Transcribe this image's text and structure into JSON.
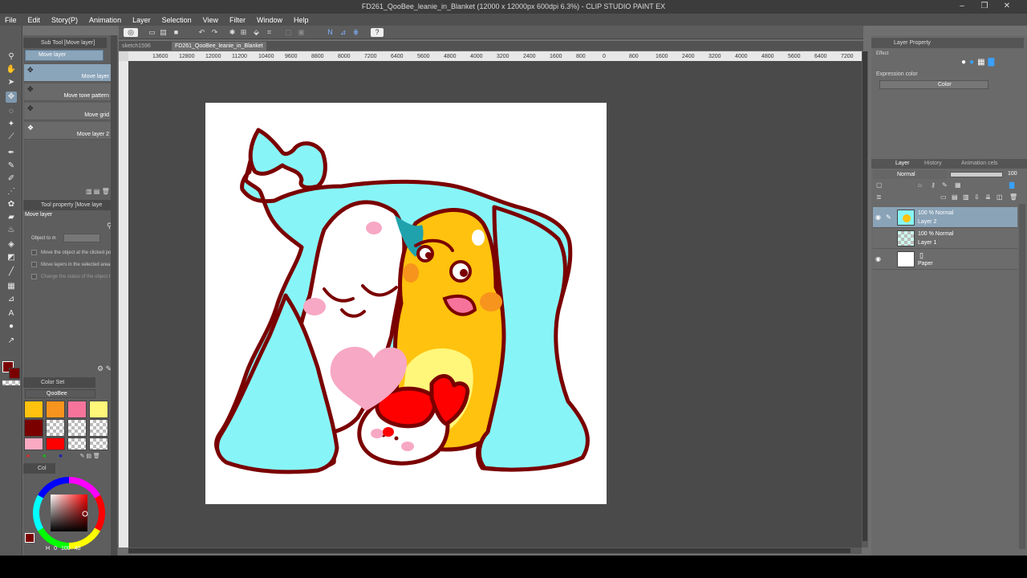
{
  "window": {
    "title": "FD261_QooBee_leanie_in_Blanket (12000 x 12000px 600dpi 6.3%)  - CLIP STUDIO PAINT EX"
  },
  "menu": [
    "File",
    "Edit",
    "Story(P)",
    "Animation",
    "Layer",
    "Selection",
    "View",
    "Filter",
    "Window",
    "Help"
  ],
  "subtool": {
    "header": "Sub Tool [Move layer]",
    "group_label": "Move layer",
    "items": [
      "Move layer",
      "Move tone pattern",
      "Move grid",
      "Move layer 2"
    ]
  },
  "tool_property": {
    "header": "Tool property [Move laye",
    "name": "Move layer",
    "object_label": "Object to m",
    "options": [
      "Move the object at the clicked pos",
      "Move layers in the selected area",
      "Change the status of the object t"
    ]
  },
  "color_set": {
    "header": "Color Set",
    "set_name": "QooBee",
    "colors": [
      "#ffc20e",
      "#f7941d",
      "#f6749c",
      "#fff77a",
      "#7a0000",
      "checker",
      "checker",
      "checker",
      "#f9a9c2",
      "#ff0000",
      "checker",
      "checker"
    ]
  },
  "color_wheel": {
    "tab": "Col",
    "h_label": "H",
    "h": "0",
    "s": "100",
    "v": "40",
    "main_color": "#7a0000"
  },
  "document_tabs": [
    "sketch1596",
    "FD261_QooBee_leanie_in_Blanket"
  ],
  "ruler_labels": [
    "13600",
    "12800",
    "12000",
    "11200",
    "10400",
    "9600",
    "8800",
    "8000",
    "7200",
    "6400",
    "5600",
    "4800",
    "4000",
    "3200",
    "2400",
    "1600",
    "800",
    "0",
    "800",
    "1600",
    "2400",
    "3200",
    "4000",
    "4800",
    "5600",
    "6400",
    "7200"
  ],
  "layer_property": {
    "header": "Layer Property",
    "effect_label": "Effect",
    "expression_label": "Expression color",
    "expression_value": "Color"
  },
  "layer_panel": {
    "tabs": [
      "Layer",
      "History",
      "Animation cels"
    ],
    "blend_mode": "Normal",
    "opacity": "100",
    "layers": [
      {
        "mode": "100 % Normal",
        "name": "Layer 2",
        "selected": true,
        "visible": true
      },
      {
        "mode": "100 % Normal",
        "name": "Layer 1",
        "selected": false,
        "visible": false
      },
      {
        "mode": "",
        "name": "Paper",
        "selected": false,
        "visible": true
      }
    ]
  },
  "colors": {
    "blanket": "#87f5f7",
    "outline": "#7a0000",
    "qoobee_yellow": "#ffc20e",
    "pink": "#f7a8c4",
    "red": "#ff0000",
    "teal": "#20a2ad"
  }
}
